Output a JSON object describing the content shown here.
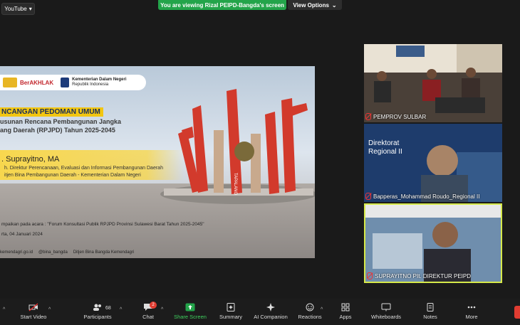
{
  "topbar": {
    "source_label": "YouTube",
    "share_banner": "You are viewing Rizal PEIPD-Bangda's screen",
    "view_options": "View Options"
  },
  "slide": {
    "logo_text_1": "BerAKHLAK",
    "ministry_name": "Kementerian Dalam Negeri",
    "ministry_sub": "Republik Indonesia",
    "title": "NCANGAN PEDOMAN UMUM",
    "subtitle_1": "usunan   Rencana   Pembangunan   Jangka",
    "subtitle_2": "ang Daerah (RPJPD) Tahun 2025-2045",
    "presenter": ". Suprayitno, MA",
    "role_1": "h. Direktur Perencanaan, Evaluasi dan Informasi Pembangunan Daerah",
    "role_2": "itjen Bina Pembangunan Daerah - Kementerian Dalam Negeri",
    "event": "mpaikan pada acara : \"Forum Konsultasi Publik RPJPD Provinsi Sulawesi Barat Tahun 2025-2045\"",
    "place_date": "rta, 04 Januari 2024",
    "footer_site": "kemendagri.go.id",
    "footer_handle": "@bina_bangda",
    "footer_channel": "Ditjen Bina Bangda Kemendagri",
    "monument_text": "TAPALANG"
  },
  "tiles": [
    {
      "name": "PEMPROV SULBAR",
      "color": "#3a3530"
    },
    {
      "name": "Bapperas_Mohammad Roudo_Regional II",
      "slide_title": "Direktorat",
      "slide_sub": "Regional II"
    },
    {
      "name": "SUPRAYITNO PIt. DIREKTUR PEIPD",
      "speaker_color": "#d6e94a"
    }
  ],
  "toolbar": {
    "start_video": "Start Video",
    "participants": "Participants",
    "participants_count": "68",
    "chat": "Chat",
    "chat_badge": "2",
    "share_screen": "Share Screen",
    "summary": "Summary",
    "ai_companion": "AI Companion",
    "reactions": "Reactions",
    "apps": "Apps",
    "whiteboards": "Whiteboards",
    "notes": "Notes",
    "more": "More"
  },
  "colors": {
    "share_green": "#23a44a",
    "slide_yellow": "#f2c611",
    "active_speaker": "#d6e94a"
  }
}
